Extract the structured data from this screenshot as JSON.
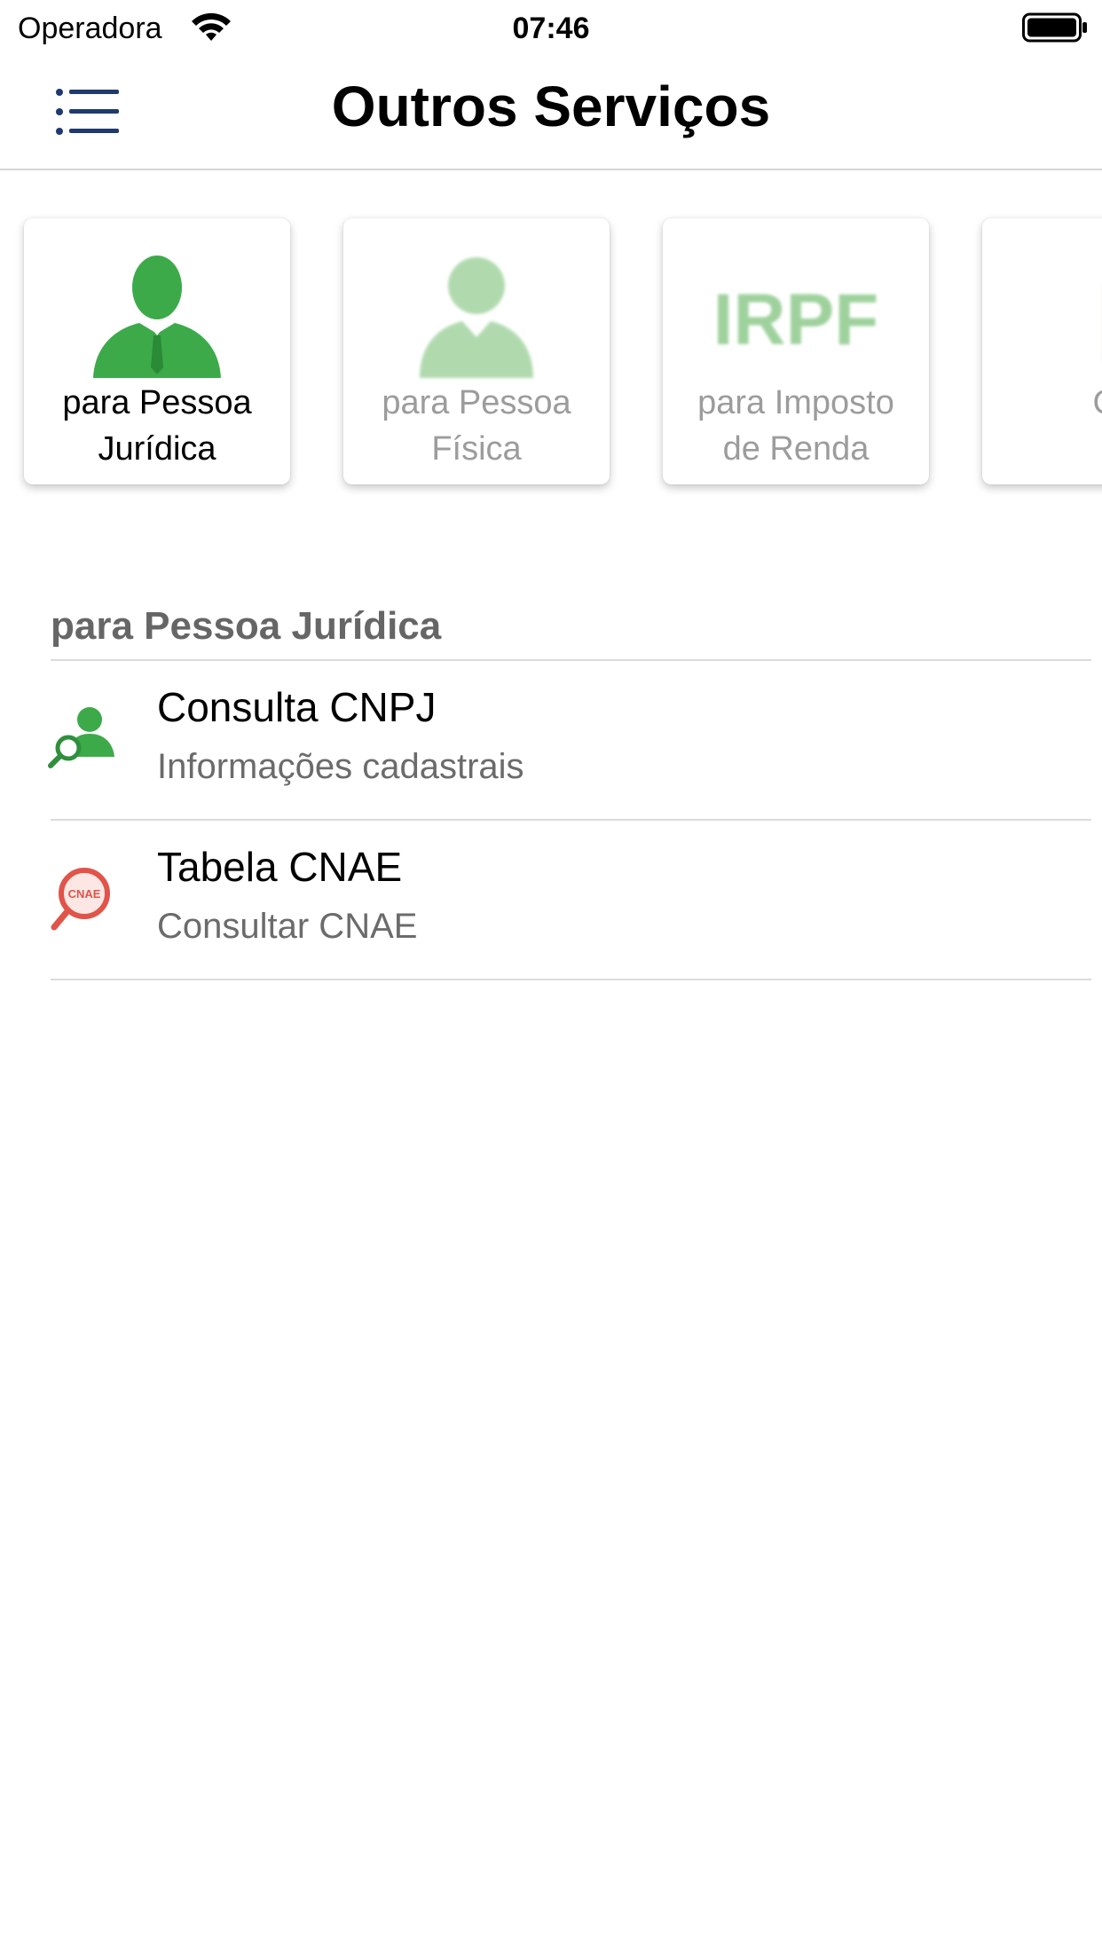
{
  "status_bar": {
    "carrier": "Operadora",
    "time": "07:46",
    "wifi_icon": "wifi-icon",
    "battery_icon": "battery-full-icon"
  },
  "nav": {
    "title": "Outros Serviços",
    "menu_icon": "list-menu-icon"
  },
  "categories": [
    {
      "label_line1": "para Pessoa",
      "label_line2": "Jurídica",
      "icon": "business-person-icon",
      "selected": true
    },
    {
      "label_line1": "para Pessoa",
      "label_line2": "Física",
      "icon": "person-icon",
      "selected": false
    },
    {
      "label_line1": "para Imposto",
      "label_line2": "de Renda",
      "icon": "irpf-text-icon",
      "icon_text": "IRPF",
      "selected": false
    },
    {
      "label_line1": "",
      "label_line2": "Ou",
      "icon": "document-icon",
      "selected": false
    }
  ],
  "section": {
    "header": "para Pessoa Jurídica",
    "items": [
      {
        "title": "Consulta CNPJ",
        "subtitle": "Informações cadastrais",
        "icon": "person-search-icon"
      },
      {
        "title": "Tabela CNAE",
        "subtitle": "Consultar CNAE",
        "icon": "cnae-search-icon",
        "icon_text": "CNAE"
      }
    ]
  },
  "colors": {
    "green": "#3daa4a",
    "light_green": "#a9d8a6",
    "red": "#e0544a",
    "menu_blue": "#1f3a6e"
  }
}
